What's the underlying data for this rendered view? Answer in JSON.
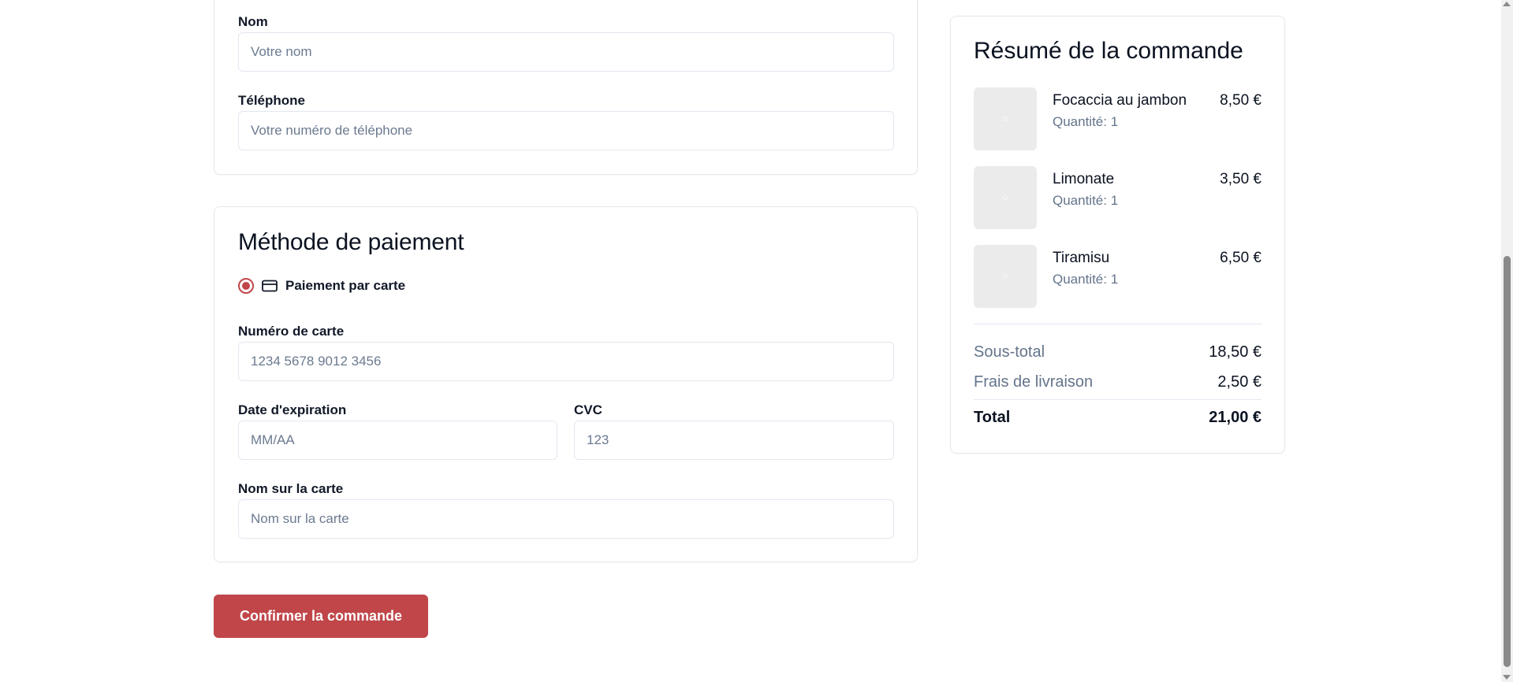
{
  "contact": {
    "name_label": "Nom",
    "name_placeholder": "Votre nom",
    "phone_label": "Téléphone",
    "phone_placeholder": "Votre numéro de téléphone"
  },
  "payment": {
    "title": "Méthode de paiement",
    "method_label": "Paiement par carte",
    "method_selected": true,
    "card_number_label": "Numéro de carte",
    "card_number_placeholder": "1234 5678 9012 3456",
    "expiry_label": "Date d'expiration",
    "expiry_placeholder": "MM/AA",
    "cvc_label": "CVC",
    "cvc_placeholder": "123",
    "card_name_label": "Nom sur la carte",
    "card_name_placeholder": "Nom sur la carte"
  },
  "confirm_label": "Confirmer la commande",
  "summary": {
    "title": "Résumé de la commande",
    "items": [
      {
        "name": "Focaccia au jambon",
        "quantity": "Quantité: 1",
        "price": "8,50 €"
      },
      {
        "name": "Limonate",
        "quantity": "Quantité: 1",
        "price": "3,50 €"
      },
      {
        "name": "Tiramisu",
        "quantity": "Quantité: 1",
        "price": "6,50 €"
      }
    ],
    "subtotal_label": "Sous-total",
    "subtotal_value": "18,50 €",
    "delivery_label": "Frais de livraison",
    "delivery_value": "2,50 €",
    "total_label": "Total",
    "total_value": "21,00 €"
  },
  "colors": {
    "accent": "#c0464a",
    "muted_text": "#64748b",
    "border": "#e2e8f0"
  },
  "icons": {
    "payment_method": "credit-card-icon",
    "item_placeholder": "image-placeholder-icon"
  }
}
